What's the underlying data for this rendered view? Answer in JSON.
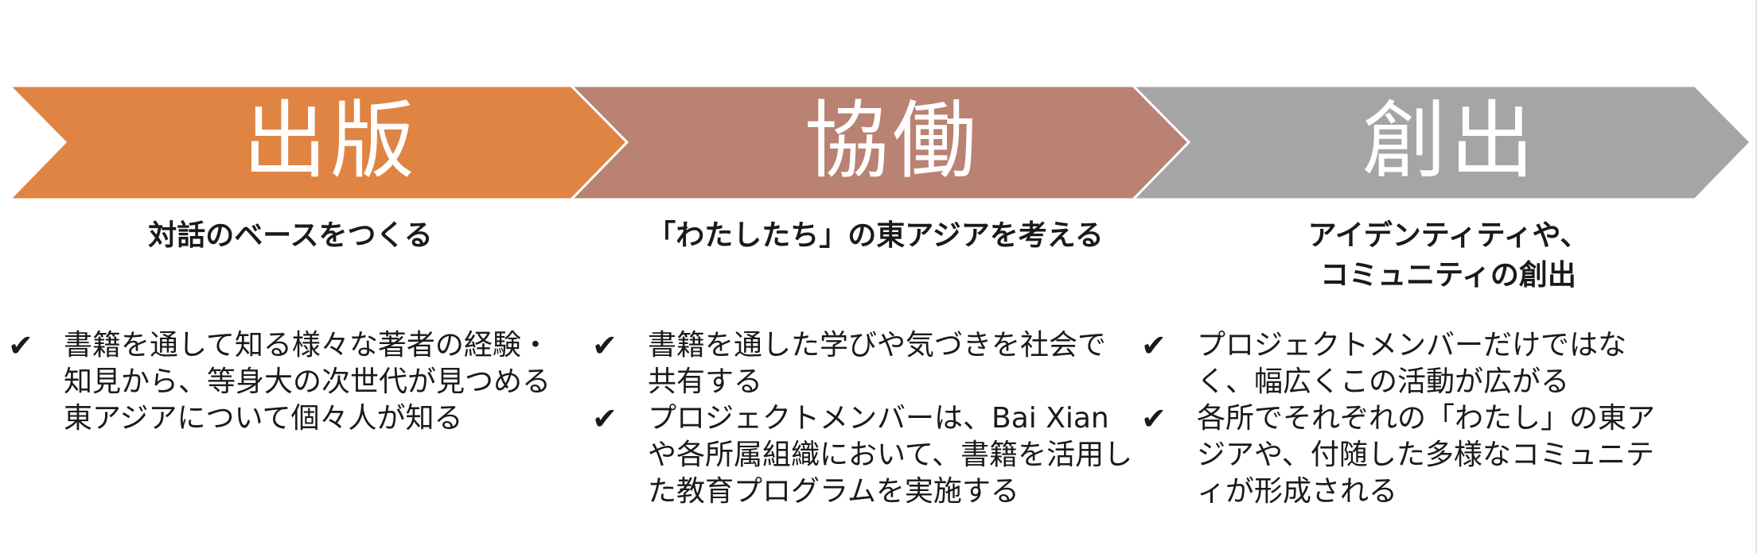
{
  "stages": [
    {
      "title": "出版",
      "color": "#e08443",
      "subtitle": [
        "対話のベースをつくる"
      ],
      "bullets": [
        "書籍を通して知る様々な著者の経験・知見から、等身大の次世代が見つめる東アジアについて個々人が知る"
      ]
    },
    {
      "title": "協働",
      "color": "#b98272",
      "subtitle": [
        "「わたしたち」の東アジアを考える"
      ],
      "bullets": [
        "書籍を通した学びや気づきを社会で共有する",
        "プロジェクトメンバーは、Bai Xianや各所属組織において、書籍を活用した教育プログラムを実施する"
      ]
    },
    {
      "title": "創出",
      "color": "#a5a5a5",
      "subtitle": [
        "アイデンティティや、",
        "コミュニティの創出"
      ],
      "bullets": [
        "プロジェクトメンバーだけではなく、幅広くこの活動が広がる",
        "各所でそれぞれの「わたし」の東アジアや、付随した多様なコミュニティが形成される"
      ]
    }
  ],
  "check_icon": "✔"
}
